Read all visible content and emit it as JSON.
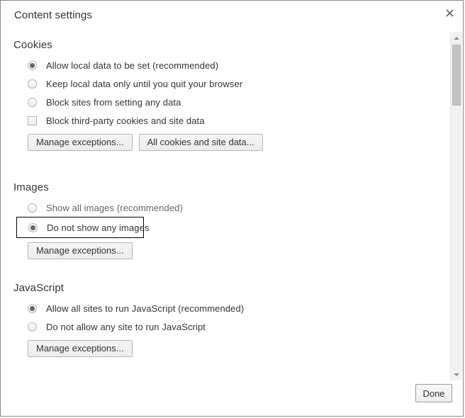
{
  "dialog": {
    "title": "Content settings",
    "close_icon": "close-icon"
  },
  "scrollbar": {
    "up_icon": "chevron-up-icon",
    "down_icon": "chevron-down-icon"
  },
  "sections": [
    {
      "heading": "Cookies",
      "options": [
        {
          "type": "radio",
          "label": "Allow local data to be set (recommended)",
          "checked": true
        },
        {
          "type": "radio",
          "label": "Keep local data only until you quit your browser",
          "checked": false
        },
        {
          "type": "radio",
          "label": "Block sites from setting any data",
          "checked": false
        },
        {
          "type": "checkbox",
          "label": "Block third-party cookies and site data",
          "checked": false
        }
      ],
      "buttons": [
        {
          "label": "Manage exceptions..."
        },
        {
          "label": "All cookies and site data..."
        }
      ]
    },
    {
      "heading": "Images",
      "options": [
        {
          "type": "radio",
          "label": "Show all images (recommended)",
          "checked": false
        },
        {
          "type": "radio",
          "label": "Do not show any images",
          "checked": true,
          "focused": true
        }
      ],
      "buttons": [
        {
          "label": "Manage exceptions..."
        }
      ]
    },
    {
      "heading": "JavaScript",
      "options": [
        {
          "type": "radio",
          "label": "Allow all sites to run JavaScript (recommended)",
          "checked": true
        },
        {
          "type": "radio",
          "label": "Do not allow any site to run JavaScript",
          "checked": false
        }
      ],
      "buttons": [
        {
          "label": "Manage exceptions..."
        }
      ]
    }
  ],
  "footer": {
    "done_label": "Done"
  }
}
